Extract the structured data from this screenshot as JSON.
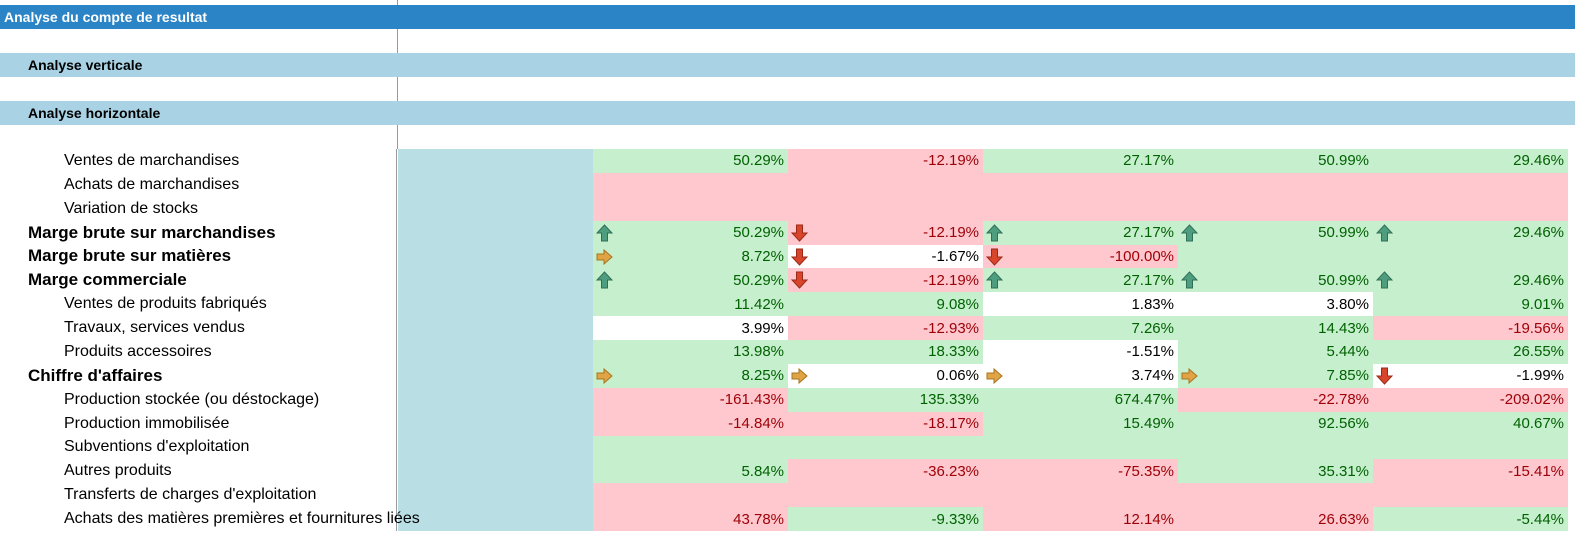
{
  "sheet": {
    "title": "Analyse du compte de resultat",
    "sections": [
      "Analyse verticale",
      "Analyse horizontale"
    ]
  },
  "colors": {
    "header_blue": "#2b84c6",
    "section_blue": "#a9d3e5",
    "teal": "#b9dfe5",
    "pos_fill": "#c6efce",
    "pos_text": "#006100",
    "neg_fill": "#ffc7ce",
    "neg_text": "#9c0006",
    "arrow_up": "#4f9d7f",
    "arrow_down": "#d9452b",
    "arrow_side": "#e0a444"
  },
  "rows": [
    {
      "label": "Ventes de marchandises",
      "style": "indent",
      "cells": [
        {
          "v": "50.29%",
          "t": "pos",
          "i": ""
        },
        {
          "v": "-12.19%",
          "t": "neg",
          "i": ""
        },
        {
          "v": "27.17%",
          "t": "pos",
          "i": ""
        },
        {
          "v": "50.99%",
          "t": "pos",
          "i": ""
        },
        {
          "v": "29.46%",
          "t": "pos",
          "i": ""
        }
      ]
    },
    {
      "label": "Achats de marchandises",
      "style": "indent",
      "cells": [
        {
          "v": "",
          "t": "neg",
          "i": ""
        },
        {
          "v": "",
          "t": "neg",
          "i": ""
        },
        {
          "v": "",
          "t": "neg",
          "i": ""
        },
        {
          "v": "",
          "t": "neg",
          "i": ""
        },
        {
          "v": "",
          "t": "neg",
          "i": ""
        }
      ]
    },
    {
      "label": "Variation de stocks",
      "style": "indent",
      "cells": [
        {
          "v": "",
          "t": "neg",
          "i": ""
        },
        {
          "v": "",
          "t": "neg",
          "i": ""
        },
        {
          "v": "",
          "t": "neg",
          "i": ""
        },
        {
          "v": "",
          "t": "neg",
          "i": ""
        },
        {
          "v": "",
          "t": "neg",
          "i": ""
        }
      ]
    },
    {
      "label": "Marge brute sur marchandises",
      "style": "bold",
      "cells": [
        {
          "v": "50.29%",
          "t": "pos",
          "i": "up"
        },
        {
          "v": "-12.19%",
          "t": "neg",
          "i": "down"
        },
        {
          "v": "27.17%",
          "t": "pos",
          "i": "up"
        },
        {
          "v": "50.99%",
          "t": "pos",
          "i": "up"
        },
        {
          "v": "29.46%",
          "t": "pos",
          "i": "up"
        }
      ]
    },
    {
      "label": "Marge brute sur matières",
      "style": "bold",
      "cells": [
        {
          "v": "8.72%",
          "t": "pos",
          "i": "side"
        },
        {
          "v": "-1.67%",
          "t": "neu",
          "i": "down"
        },
        {
          "v": "-100.00%",
          "t": "neg",
          "i": "down"
        },
        {
          "v": "",
          "t": "pos",
          "i": ""
        },
        {
          "v": "",
          "t": "pos",
          "i": ""
        }
      ]
    },
    {
      "label": "Marge commerciale",
      "style": "bold",
      "cells": [
        {
          "v": "50.29%",
          "t": "pos",
          "i": "up"
        },
        {
          "v": "-12.19%",
          "t": "neg",
          "i": "down"
        },
        {
          "v": "27.17%",
          "t": "pos",
          "i": "up"
        },
        {
          "v": "50.99%",
          "t": "pos",
          "i": "up"
        },
        {
          "v": "29.46%",
          "t": "pos",
          "i": "up"
        }
      ]
    },
    {
      "label": "Ventes de produits fabriqués",
      "style": "indent",
      "cells": [
        {
          "v": "11.42%",
          "t": "pos",
          "i": ""
        },
        {
          "v": "9.08%",
          "t": "pos",
          "i": ""
        },
        {
          "v": "1.83%",
          "t": "neu",
          "i": ""
        },
        {
          "v": "3.80%",
          "t": "neu",
          "i": ""
        },
        {
          "v": "9.01%",
          "t": "pos",
          "i": ""
        }
      ]
    },
    {
      "label": "Travaux, services vendus",
      "style": "indent",
      "cells": [
        {
          "v": "3.99%",
          "t": "neu",
          "i": ""
        },
        {
          "v": "-12.93%",
          "t": "neg",
          "i": ""
        },
        {
          "v": "7.26%",
          "t": "pos",
          "i": ""
        },
        {
          "v": "14.43%",
          "t": "pos",
          "i": ""
        },
        {
          "v": "-19.56%",
          "t": "neg",
          "i": ""
        }
      ]
    },
    {
      "label": "Produits accessoires",
      "style": "indent",
      "cells": [
        {
          "v": "13.98%",
          "t": "pos",
          "i": ""
        },
        {
          "v": "18.33%",
          "t": "pos",
          "i": ""
        },
        {
          "v": "-1.51%",
          "t": "neu",
          "i": ""
        },
        {
          "v": "5.44%",
          "t": "pos",
          "i": ""
        },
        {
          "v": "26.55%",
          "t": "pos",
          "i": ""
        }
      ]
    },
    {
      "label": "Chiffre d'affaires",
      "style": "bold",
      "cells": [
        {
          "v": "8.25%",
          "t": "pos",
          "i": "side"
        },
        {
          "v": "0.06%",
          "t": "neu",
          "i": "side"
        },
        {
          "v": "3.74%",
          "t": "neu",
          "i": "side"
        },
        {
          "v": "7.85%",
          "t": "pos",
          "i": "side"
        },
        {
          "v": "-1.99%",
          "t": "neu",
          "i": "down"
        }
      ]
    },
    {
      "label": "Production stockée (ou déstockage)",
      "style": "indent",
      "cells": [
        {
          "v": "-161.43%",
          "t": "neg",
          "i": ""
        },
        {
          "v": "135.33%",
          "t": "pos",
          "i": ""
        },
        {
          "v": "674.47%",
          "t": "pos",
          "i": ""
        },
        {
          "v": "-22.78%",
          "t": "neg",
          "i": ""
        },
        {
          "v": "-209.02%",
          "t": "neg",
          "i": ""
        }
      ]
    },
    {
      "label": "Production immobilisée",
      "style": "indent",
      "cells": [
        {
          "v": "-14.84%",
          "t": "neg",
          "i": ""
        },
        {
          "v": "-18.17%",
          "t": "neg",
          "i": ""
        },
        {
          "v": "15.49%",
          "t": "pos",
          "i": ""
        },
        {
          "v": "92.56%",
          "t": "pos",
          "i": ""
        },
        {
          "v": "40.67%",
          "t": "pos",
          "i": ""
        }
      ]
    },
    {
      "label": "Subventions d'exploitation",
      "style": "indent",
      "cells": [
        {
          "v": "",
          "t": "pos",
          "i": ""
        },
        {
          "v": "",
          "t": "pos",
          "i": ""
        },
        {
          "v": "",
          "t": "pos",
          "i": ""
        },
        {
          "v": "",
          "t": "pos",
          "i": ""
        },
        {
          "v": "",
          "t": "pos",
          "i": ""
        }
      ]
    },
    {
      "label": "Autres produits",
      "style": "indent",
      "cells": [
        {
          "v": "5.84%",
          "t": "pos",
          "i": ""
        },
        {
          "v": "-36.23%",
          "t": "neg",
          "i": ""
        },
        {
          "v": "-75.35%",
          "t": "neg",
          "i": ""
        },
        {
          "v": "35.31%",
          "t": "pos",
          "i": ""
        },
        {
          "v": "-15.41%",
          "t": "neg",
          "i": ""
        }
      ]
    },
    {
      "label": "Transferts de charges d'exploitation",
      "style": "indent",
      "cells": [
        {
          "v": "",
          "t": "neg",
          "i": ""
        },
        {
          "v": "",
          "t": "neg",
          "i": ""
        },
        {
          "v": "",
          "t": "neg",
          "i": ""
        },
        {
          "v": "",
          "t": "neg",
          "i": ""
        },
        {
          "v": "",
          "t": "neg",
          "i": ""
        }
      ]
    },
    {
      "label": "Achats des matières premières et fournitures liées",
      "style": "indent",
      "cells": [
        {
          "v": "43.78%",
          "t": "neg",
          "i": ""
        },
        {
          "v": "-9.33%",
          "t": "pos",
          "i": ""
        },
        {
          "v": "12.14%",
          "t": "neg",
          "i": ""
        },
        {
          "v": "26.63%",
          "t": "neg",
          "i": ""
        },
        {
          "v": "-5.44%",
          "t": "pos",
          "i": ""
        }
      ]
    }
  ]
}
